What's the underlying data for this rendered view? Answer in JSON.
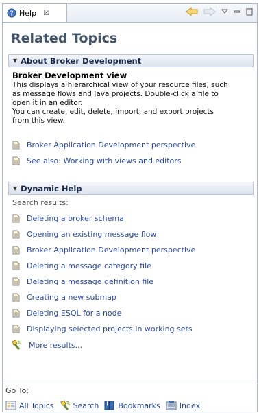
{
  "tab": {
    "title": "Help",
    "close": "☒"
  },
  "page": {
    "title": "Related Topics"
  },
  "about": {
    "header": "About Broker Development",
    "heading": "Broker Development view",
    "lines": [
      "This displays a hierarchical view of your resource files, such",
      "as message flows and Java projects. Double-click a file to",
      "open it in an editor.",
      "You can create, edit, delete, import, and export projects",
      "from this view."
    ],
    "links": [
      "Broker Application Development perspective",
      "See also: Working with views and editors"
    ]
  },
  "dynamic": {
    "header": "Dynamic Help",
    "search_label": "Search results:",
    "results": [
      "Deleting a broker schema",
      "Opening an existing message flow",
      "Broker Application Development perspective",
      "Deleting a message category file",
      "Deleting a message definition file",
      "Creating a new submap",
      "Deleting ESQL for a node",
      "Displaying selected projects in working sets"
    ],
    "more": "More results..."
  },
  "goto": {
    "label": "Go To:",
    "items": [
      "All Topics",
      "Search",
      "Bookmarks",
      "Index"
    ]
  }
}
